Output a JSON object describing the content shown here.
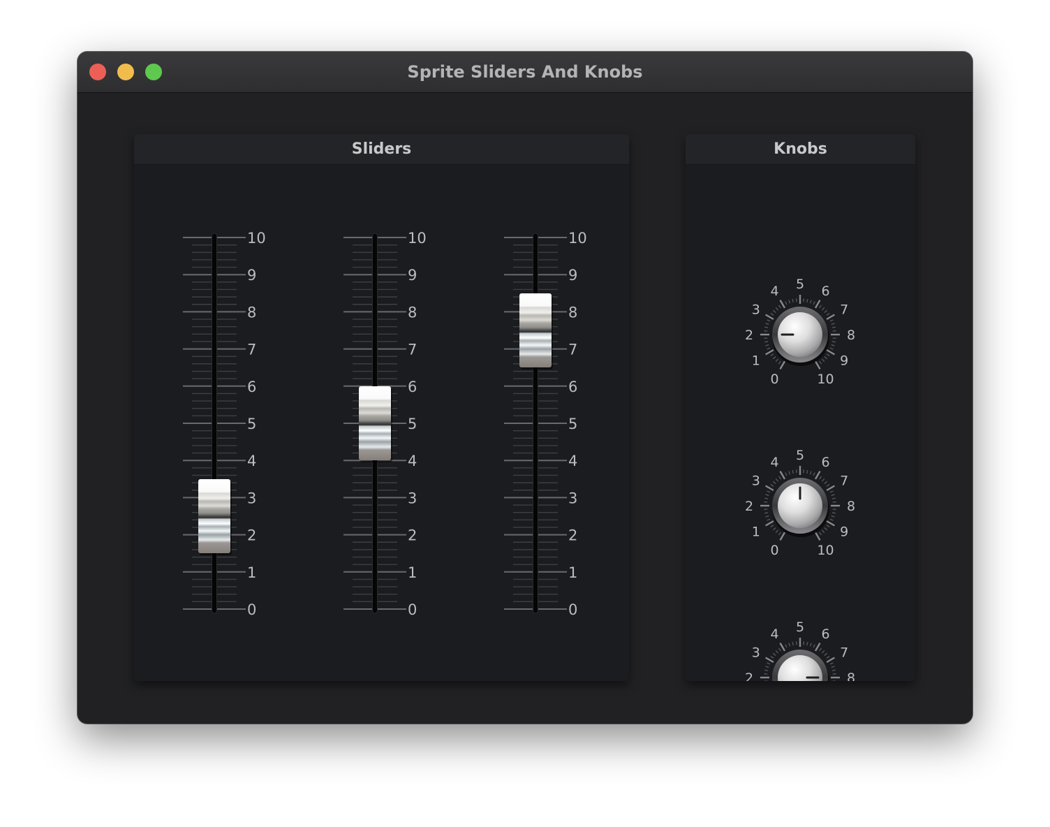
{
  "window": {
    "title": "Sprite Sliders And Knobs",
    "traffic_lights": {
      "close_color": "#ec5f57",
      "minimize_color": "#f0bd4d",
      "maximize_color": "#5fc84f"
    }
  },
  "sliders_panel": {
    "title": "Sliders",
    "scale_labels": [
      "0",
      "1",
      "2",
      "3",
      "4",
      "5",
      "6",
      "7",
      "8",
      "9",
      "10"
    ],
    "min": 0,
    "max": 10,
    "values": [
      2.5,
      5.0,
      7.5
    ]
  },
  "knobs_panel": {
    "title": "Knobs",
    "scale_labels": [
      "0",
      "1",
      "2",
      "3",
      "4",
      "5",
      "6",
      "7",
      "8",
      "9",
      "10"
    ],
    "min": 0,
    "max": 10,
    "values": [
      2,
      5,
      8
    ]
  },
  "colors": {
    "window_bg": "#212124",
    "panel_bg": "#1b1c1f",
    "label_text": "#bdbdc1",
    "title_text": "#b4b4b6"
  }
}
